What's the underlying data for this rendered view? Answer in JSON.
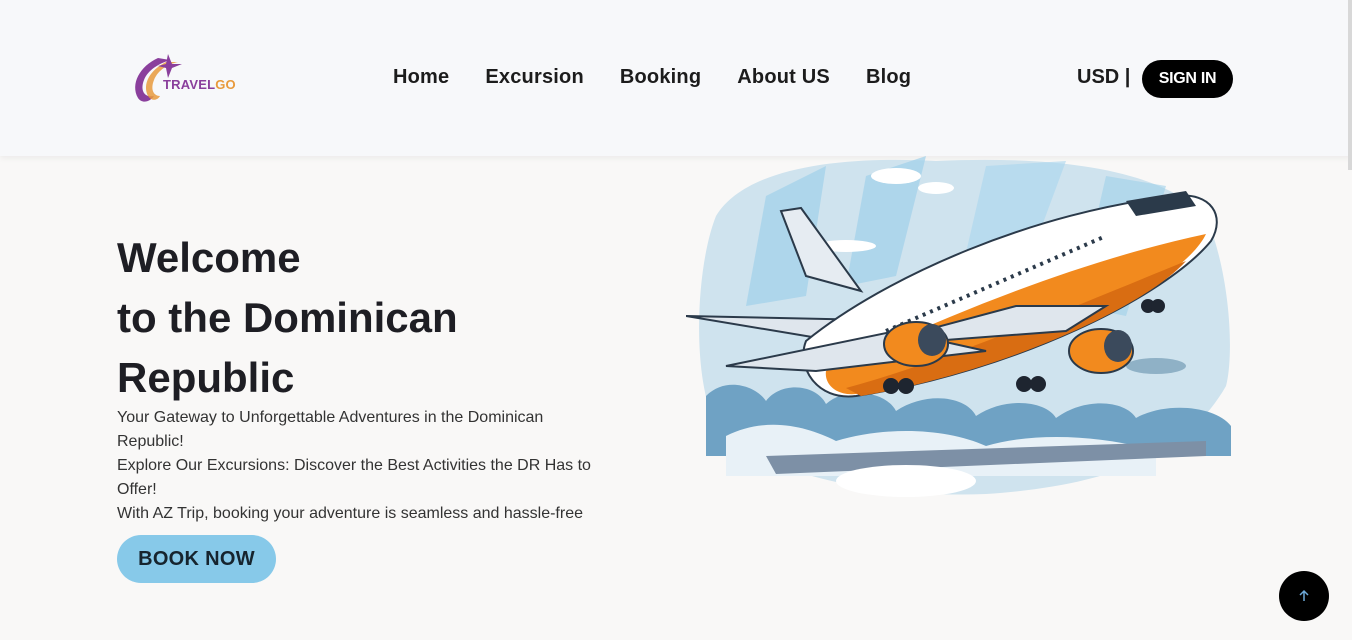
{
  "logo": {
    "text_a": "TRAVEL",
    "text_b": "GO"
  },
  "nav": {
    "items": [
      "Home",
      "Excursion",
      "Booking",
      "About US",
      "Blog"
    ]
  },
  "header": {
    "currency": "USD |",
    "signin_label": "SIGN IN"
  },
  "hero": {
    "title_lines": [
      "Welcome",
      "to the Dominican",
      "Republic"
    ],
    "description_lines": [
      "Your Gateway to Unforgettable Adventures in the Dominican",
      "Republic!",
      "Explore Our Excursions: Discover the Best Activities the DR Has to",
      "Offer!",
      "With AZ Trip, booking your adventure is seamless and hassle-free"
    ],
    "cta_label": "BOOK NOW"
  },
  "icons": {
    "back_to_top": "arrow-up-icon",
    "illustration": "airplane-illustration"
  },
  "colors": {
    "cta": "#87c9e9",
    "signin": "#000000",
    "logo_purple": "#8a3f9c",
    "logo_orange": "#e89a3c",
    "plane_orange": "#f28a1e"
  }
}
